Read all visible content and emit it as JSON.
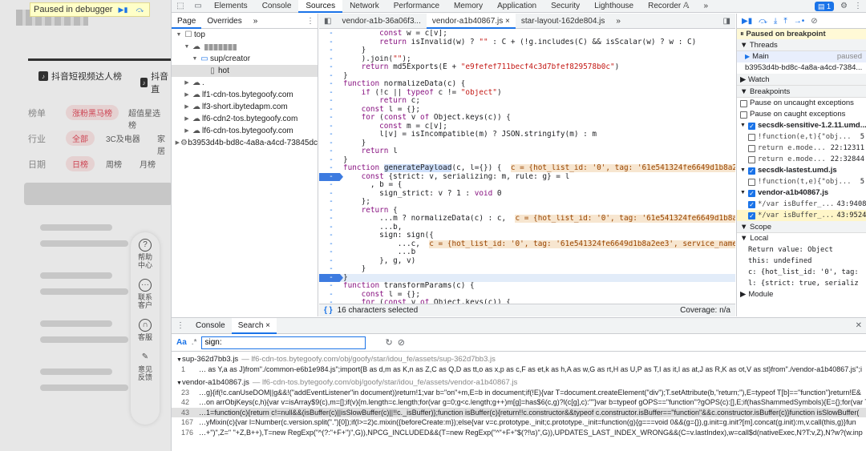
{
  "debugger_banner": {
    "text": "Paused in debugger"
  },
  "webpage": {
    "tabs": [
      "抖音短视频达人榜",
      "抖音直"
    ],
    "rows": [
      {
        "label": "榜单",
        "chips": [
          "涨粉黑马榜",
          "超值星选榜"
        ]
      },
      {
        "label": "行业",
        "chips": [
          "全部",
          "3C及电器",
          "家居"
        ]
      },
      {
        "label": "日期",
        "chips": [
          "日榜",
          "周榜",
          "月榜"
        ]
      }
    ],
    "side": [
      {
        "icon": "?",
        "label": "帮助中心"
      },
      {
        "icon": "···",
        "label": "联系客户"
      },
      {
        "icon": "∩",
        "label": "客服"
      },
      {
        "icon": "✎",
        "label": "意见反馈"
      }
    ]
  },
  "devtools": {
    "main_tabs": [
      "Elements",
      "Console",
      "Sources",
      "Network",
      "Performance",
      "Memory",
      "Application",
      "Security",
      "Lighthouse",
      "Recorder 𝔸",
      "»"
    ],
    "active_tab": "Sources",
    "issues_badge": "1",
    "navigator": {
      "tabs": [
        "Page",
        "Overrides",
        "»"
      ],
      "tree": [
        {
          "label": "top",
          "icon": "☐",
          "arrow": "▼",
          "indent": 0
        },
        {
          "label": "",
          "icon": "☁",
          "arrow": "▼",
          "indent": 1,
          "blur": true
        },
        {
          "label": "sup/creator",
          "icon": "📁",
          "arrow": "▼",
          "indent": 2
        },
        {
          "label": "hot",
          "icon": "▯",
          "arrow": "",
          "indent": 3,
          "selected": true
        },
        {
          "label": ".",
          "icon": "☁",
          "arrow": "▶",
          "indent": 1
        },
        {
          "label": "lf1-cdn-tos.bytegoofy.com",
          "icon": "☁",
          "arrow": "▶",
          "indent": 1
        },
        {
          "label": "lf3-short.ibytedapm.com",
          "icon": "☁",
          "arrow": "▶",
          "indent": 1
        },
        {
          "label": "lf6-cdn2-tos.bytegoofy.com",
          "icon": "☁",
          "arrow": "▶",
          "indent": 1
        },
        {
          "label": "lf6-cdn-tos.bytegoofy.com",
          "icon": "☁",
          "arrow": "▶",
          "indent": 1
        },
        {
          "label": "b3953d4b-bd8c-4a8a-a4cd-73845dc",
          "icon": "⚙",
          "arrow": "▶",
          "indent": 0
        }
      ]
    },
    "editor": {
      "tabs": [
        "vendor-a1b-36a06f3...",
        "vendor-a1b40867.js ×",
        "star-layout-162de804.js",
        "»"
      ],
      "lines": [
        {
          "g": "-",
          "t": "        const w = c[v];"
        },
        {
          "g": "-",
          "t": "        return isInvalid(w) ? \"\" : C + (!g.includes(C) && isScalar(w) ? w : C)"
        },
        {
          "g": "-",
          "t": "    }"
        },
        {
          "g": "-",
          "t": "    ).join(\"\");"
        },
        {
          "g": "-",
          "t": "    return md5Exports(E + \"e9fefef711becf4c3d7bfef829578b0c\")"
        },
        {
          "g": "-",
          "t": "}"
        },
        {
          "g": "-",
          "t": "function normalizeData(c) {"
        },
        {
          "g": "-",
          "t": "    if (!c || typeof c != \"object\")"
        },
        {
          "g": "-",
          "t": "        return c;"
        },
        {
          "g": "-",
          "t": "    const l = {};"
        },
        {
          "g": "-",
          "t": "    for (const v of Object.keys(c)) {"
        },
        {
          "g": "-",
          "t": "        const m = c[v];"
        },
        {
          "g": "-",
          "t": "        l[v] = isIncompatible(m) ? JSON.stringify(m) : m"
        },
        {
          "g": "-",
          "t": "    }"
        },
        {
          "g": "-",
          "t": "    return l"
        },
        {
          "g": "-",
          "t": "}"
        },
        {
          "g": "-",
          "t": "function generatePayload(c, l={}) {  c = {hot_list_id: '0', tag: '61e541324fe6649d1b8a2ee"
        },
        {
          "g": "-",
          "t": "    const {strict: v, serializing: m, rule: g} = l",
          "bp": true
        },
        {
          "g": "-",
          "t": "      , b = {"
        },
        {
          "g": "-",
          "t": "        sign_strict: v ? 1 : void 0"
        },
        {
          "g": "-",
          "t": "    };"
        },
        {
          "g": "-",
          "t": "    return {"
        },
        {
          "g": "-",
          "t": "        ...m ? normalizeData(c) : c,  c = {hot_list_id: '0', tag: '61e541324fe6649d1b8a2e"
        },
        {
          "g": "-",
          "t": "        ...b,"
        },
        {
          "g": "-",
          "t": "        sign: sign({"
        },
        {
          "g": "-",
          "t": "            ...c,  c = {hot_list_id: '0', tag: '61e541324fe6649d1b8a2ee3', service_name:"
        },
        {
          "g": "-",
          "t": "            ...b"
        },
        {
          "g": "-",
          "t": "        }, g, v)"
        },
        {
          "g": "-",
          "t": "    }"
        },
        {
          "g": "-",
          "t": "}",
          "bp": true,
          "cur": true
        },
        {
          "g": "-",
          "t": "function transformParams(c) {"
        },
        {
          "g": "-",
          "t": "    const l = {};"
        },
        {
          "g": "-",
          "t": "    for (const v of Object.keys(c)) {"
        },
        {
          "g": "-",
          "t": "        const m = c[v];"
        }
      ],
      "status_left": "{ }",
      "status_text": "16 characters selected",
      "status_right": "Coverage: n/a"
    },
    "right": {
      "paused": "Paused on breakpoint",
      "threads_label": "Threads",
      "thread_main": "Main",
      "thread_main_status": "paused",
      "thread_other": "b3953d4b-bd8c-4a8a-a4cd-7384...",
      "watch_label": "Watch",
      "breakpoints_label": "Breakpoints",
      "bp_uncaught": "Pause on uncaught exceptions",
      "bp_caught": "Pause on caught exceptions",
      "groups": [
        {
          "file": "secsdk-sensitive-1.2.11.umd....",
          "items": [
            {
              "code": "!function(e,t){\"obj...",
              "line": "5"
            },
            {
              "code": "return e.mode...",
              "line": "22:12311"
            },
            {
              "code": "return e.mode...",
              "line": "22:32844"
            }
          ]
        },
        {
          "file": "secsdk-lastest.umd.js",
          "items": [
            {
              "code": "!function(t,e){\"obj...",
              "line": "5"
            }
          ]
        },
        {
          "file": "vendor-a1b40867.js",
          "items": [
            {
              "code": "*/var isBuffer_...",
              "line": "43:9408",
              "checked": true
            },
            {
              "code": "*/var isBuffer_...",
              "line": "43:9524",
              "checked": true,
              "hl": true
            }
          ]
        }
      ],
      "scope_label": "Scope",
      "local_label": "Local",
      "scope_rows": [
        "Return value: Object",
        "this: undefined",
        "c: {hot_list_id: '0', tag:",
        "l: {strict: true, serializ"
      ],
      "module_label": "Module"
    },
    "drawer": {
      "tabs": [
        "Console",
        "Search ×"
      ],
      "aa": "Aa",
      "regex": ".*",
      "search_value": "sign:",
      "results": [
        {
          "file": "sup-362d7bb3.js",
          "path": "— lf6-cdn-tos.bytegoofy.com/obj/goofy/star/idou_fe/assets/sup-362d7bb3.js",
          "lines": [
            {
              "n": "1",
              "t": "… as Y,a as J}from\"./common-e6b1e984.js\";import{B as d,m as K,n as Z,C as Q,D as tt,o as x,p as c,F as et,k as h,A as w,G as rt,H as U,P as T,I as it,l as at,J as R,K as ot,V as st}from\"./vendor-a1b40867.js\";i"
            }
          ]
        },
        {
          "file": "vendor-a1b40867.js",
          "path": "— lf6-cdn-tos.bytegoofy.com/obj/goofy/star/idou_fe/assets/vendor-a1b40867.js",
          "lines": [
            {
              "n": "23",
              "t": "…g}{if(!c.canUseDOM||g&&!(\"addEventListener\"in document))return!1;var b=\"on\"+m,E=b in document;if(!E){var T=document.createElement(\"div\");T.setAttribute(b,\"return;\"),E=typeof T[b]==\"function\"}return!E&"
            },
            {
              "n": "42",
              "t": "…on arrObjKeys(c,h){var v=isArray$9(c),m=[];if(v){m.length=c.length;for(var g=0;g<c.length;g++)m[g]=has$6(c,g)?l(c[g],c):\"\"}var b=typeof gOPS==\"function\"?gOPS(c):[],E;if(hasShammedSymbols){E={};for(var T"
            },
            {
              "n": "43",
              "t": "…1=function(c){return c!=null&&(isBuffer(c)||isSlowBuffer(c)||!!c._isBuffer)};function isBuffer(c){return!!c.constructor&&typeof c.constructor.isBuffer==\"function\"&&c.constructor.isBuffer(c)}function isSlowBuffer(",
              "sel": true
            },
            {
              "n": "167",
              "t": "…yMixin(c){var l=Number(c.version.split(\".\")[0]);if(l>=2)c.mixin({beforeCreate:m});else{var v=c.prototype._init;c.prototype._init=function(g){g===void 0&&(g={}),g.init=g.init?[m].concat(g.init):m,v.call(this,g)}fun"
            },
            {
              "n": "176",
              "t": "…+\")\",Z=\" \"+Z,B++),T=new RegExp(\"^(?:\"+F+\")\",G)),NPCG_INCLUDED&&(T=new RegExp(\"^\"+F+\"$(?!\\s)\",G)),UPDATES_LAST_INDEX_WRONG&&(C=v.lastIndex),w=call$d(nativeExec,N?T:v,Z),N?w?(w.inp"
            }
          ]
        }
      ]
    }
  }
}
